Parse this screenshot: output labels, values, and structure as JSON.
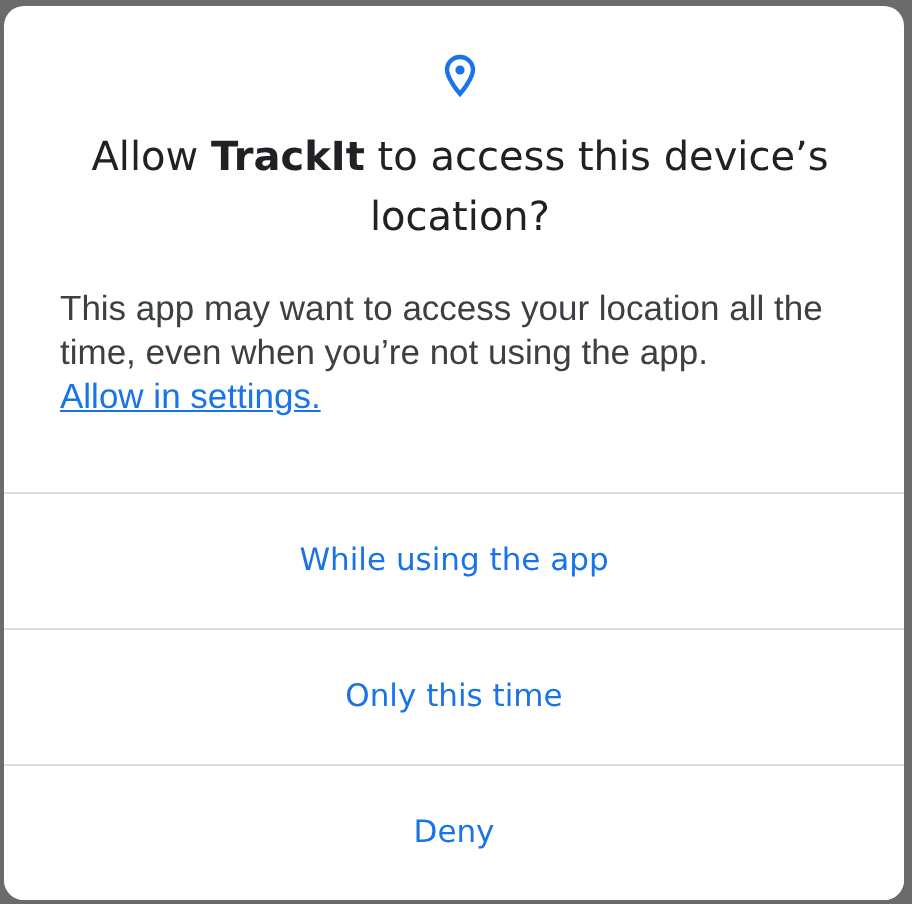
{
  "dialog": {
    "title": "Allow **TrackIt** to access this device’s location?",
    "message": "This app may want to access your location all the time, even when you’re not using the app.",
    "settings_link": "Allow in settings.",
    "buttons": [
      {
        "label": "While using the app"
      },
      {
        "label": "Only this time"
      },
      {
        "label": "Deny"
      }
    ]
  }
}
